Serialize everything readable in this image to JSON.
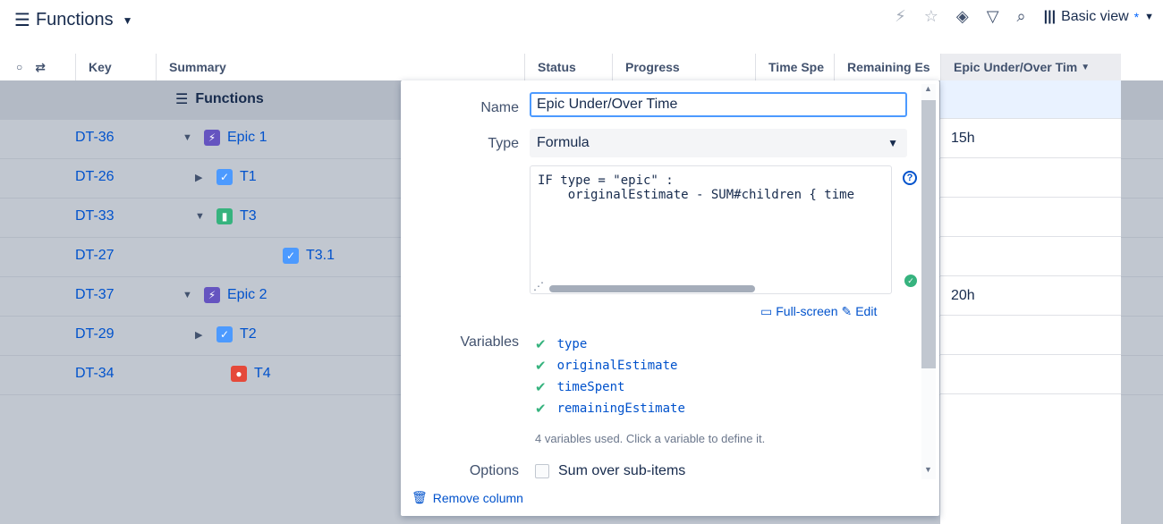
{
  "header": {
    "title": "Functions",
    "view_label": "Basic view",
    "view_modified": "*"
  },
  "columns": {
    "key": "Key",
    "summary": "Summary",
    "status": "Status",
    "progress": "Progress",
    "time_spent": "Time Spe",
    "remaining": "Remaining Es",
    "epic_under_over": "Epic Under/Over Tim"
  },
  "group_label": "Functions",
  "rows": [
    {
      "key": "DT-36",
      "summary": "Epic 1",
      "type": "epic",
      "value": "15h"
    },
    {
      "key": "DT-26",
      "summary": "T1",
      "type": "task",
      "value": ""
    },
    {
      "key": "DT-33",
      "summary": "T3",
      "type": "story",
      "value": ""
    },
    {
      "key": "DT-27",
      "summary": "T3.1",
      "type": "task",
      "value": ""
    },
    {
      "key": "DT-37",
      "summary": "Epic 2",
      "type": "epic",
      "value": "20h"
    },
    {
      "key": "DT-29",
      "summary": "T2",
      "type": "task",
      "value": ""
    },
    {
      "key": "DT-34",
      "summary": "T4",
      "type": "bug",
      "value": ""
    }
  ],
  "panel": {
    "name_label": "Name",
    "name_value": "Epic Under/Over Time",
    "type_label": "Type",
    "type_value": "Formula",
    "formula_line1": "IF type = \"epic\" :",
    "formula_line2": "    originalEstimate - SUM#children { time",
    "fullscreen_label": "Full-screen",
    "edit_label": "Edit",
    "variables_label": "Variables",
    "variables": [
      "type",
      "originalEstimate",
      "timeSpent",
      "remainingEstimate"
    ],
    "variables_hint": "4 variables used. Click a variable to define it.",
    "options_label": "Options",
    "option_sum": "Sum over sub-items",
    "remove_label": "Remove column"
  }
}
